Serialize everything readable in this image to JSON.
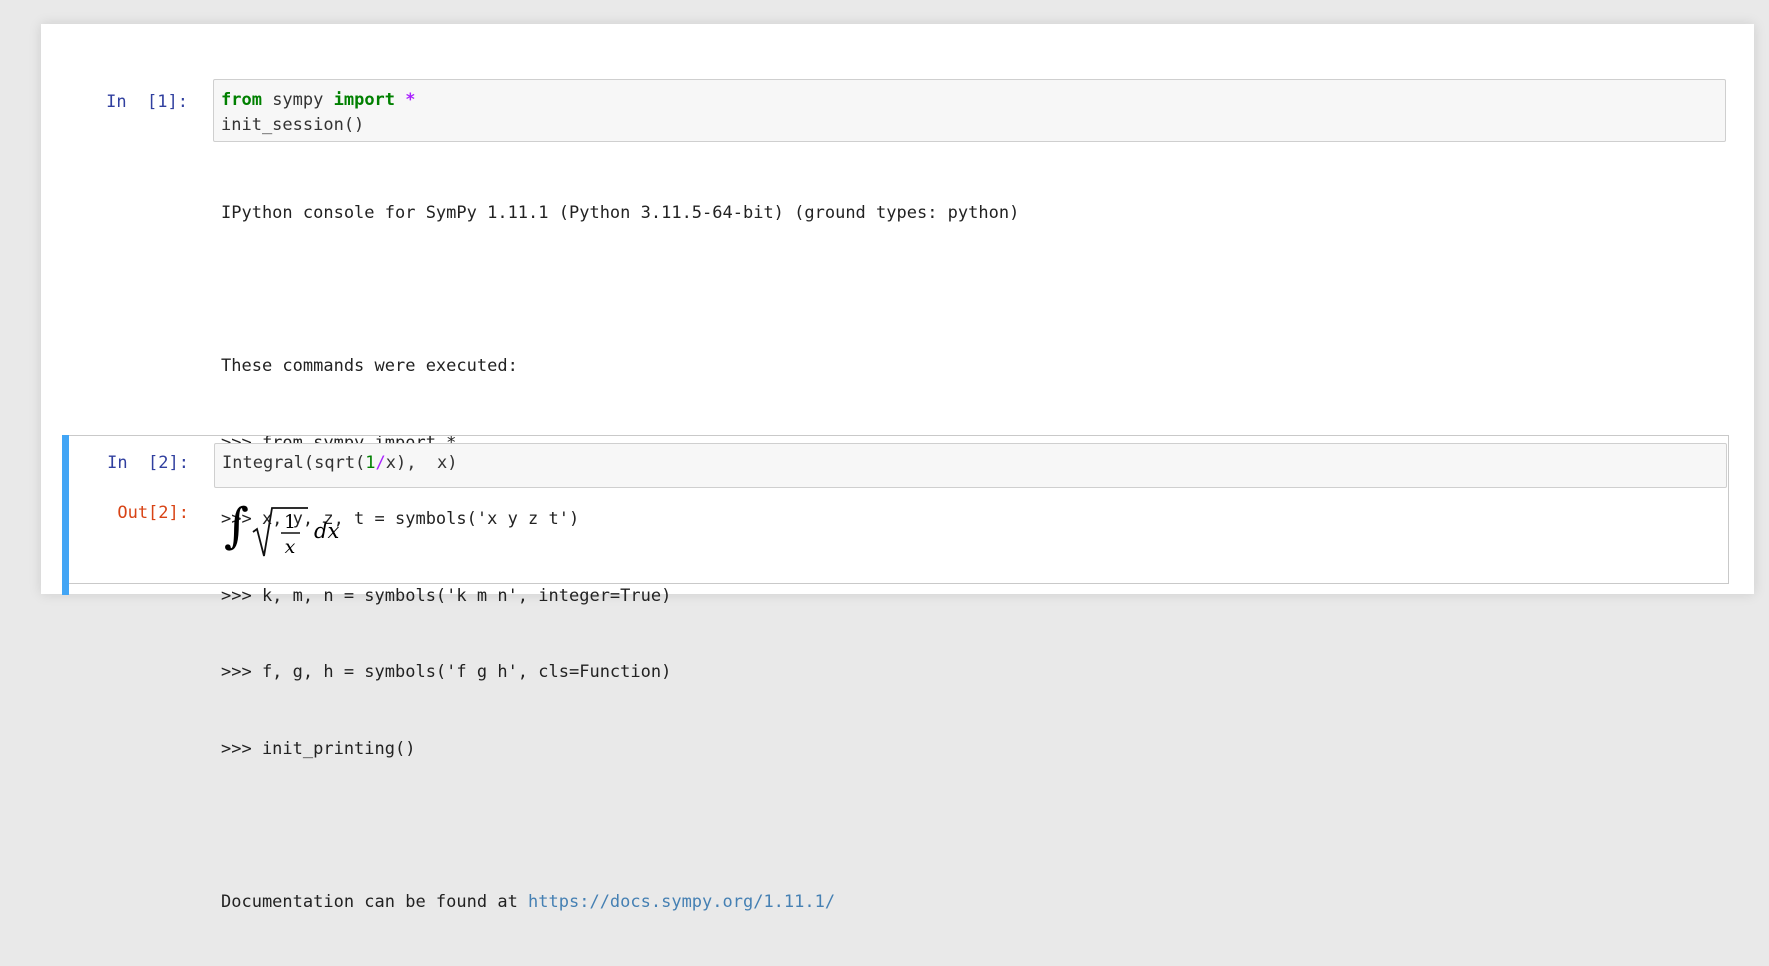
{
  "cells": [
    {
      "prompt": "In  [1]:",
      "code": {
        "line1_kw1": "from",
        "line1_mod": " sympy ",
        "line1_kw2": "import",
        "line1_sp": " ",
        "line1_star": "*",
        "line2": "init_session()"
      },
      "output_lines": [
        "IPython console for SymPy 1.11.1 (Python 3.11.5-64-bit) (ground types: python)",
        "",
        "These commands were executed:",
        ">>> from sympy import *",
        ">>> x, y, z, t = symbols('x y z t')",
        ">>> k, m, n = symbols('k m n', integer=True)",
        ">>> f, g, h = symbols('f g h', cls=Function)",
        ">>> init_printing()",
        ""
      ],
      "doc_prefix": "Documentation can be found at ",
      "doc_link": "https://docs.sympy.org/1.11.1/"
    },
    {
      "prompt": "In  [2]:",
      "code": {
        "a": "Integral(sqrt(",
        "one": "1",
        "slash": "/",
        "b": "x),  x)"
      },
      "out_prompt": "Out[2]:",
      "math": {
        "integral_sign": "∫",
        "numerator": "1",
        "denominator": "x",
        "differential": "dx"
      }
    }
  ],
  "colors": {
    "in_prompt": "#303f9f",
    "out_prompt": "#d84315",
    "selected_bar": "#42a5f5",
    "keyword": "#008000",
    "operator": "#aa22ff"
  }
}
